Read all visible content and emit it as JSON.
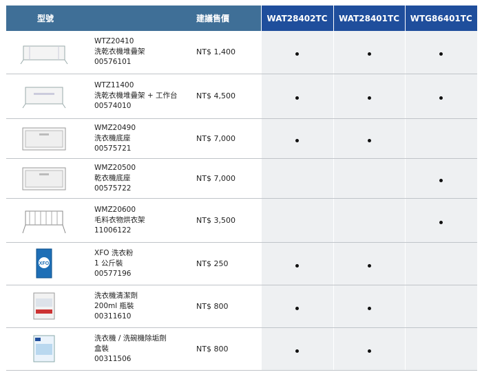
{
  "header": {
    "type_label": "型號",
    "price_label": "建議售價",
    "models": [
      "WAT28402TC",
      "WAT28401TC",
      "WTG86401TC"
    ]
  },
  "rows": [
    {
      "code": "WTZ20410",
      "name": "洗乾衣機堆疊架",
      "part": "00576101",
      "price": "NT$ 1,400",
      "marks": [
        true,
        true,
        true
      ],
      "icon": "stacking-kit-icon"
    },
    {
      "code": "WTZ11400",
      "name": "洗乾衣機堆疊架 + 工作台",
      "part": "00574010",
      "price": "NT$ 4,500",
      "marks": [
        true,
        true,
        true
      ],
      "icon": "stacking-kit-table-icon"
    },
    {
      "code": "WMZ20490",
      "name": "洗衣機底座",
      "part": "00575721",
      "price": "NT$ 7,000",
      "marks": [
        true,
        true,
        false
      ],
      "icon": "pedestal-drawer-icon"
    },
    {
      "code": "WMZ20500",
      "name": "乾衣機底座",
      "part": "00575722",
      "price": "NT$ 7,000",
      "marks": [
        false,
        false,
        true
      ],
      "icon": "pedestal-drawer-icon"
    },
    {
      "code": "WMZ20600",
      "name": "毛料衣物烘衣架",
      "part": "11006122",
      "price": "NT$ 3,500",
      "marks": [
        false,
        false,
        true
      ],
      "icon": "drying-rack-icon"
    },
    {
      "code": "XFO 洗衣粉",
      "name": "1 公斤裝",
      "part": "00577196",
      "price": "NT$ 250",
      "marks": [
        true,
        true,
        false
      ],
      "icon": "detergent-box-icon"
    },
    {
      "code": "洗衣機清潔劑",
      "name": "200ml 瓶裝",
      "part": "00311610",
      "price": "NT$ 800",
      "marks": [
        true,
        true,
        false
      ],
      "icon": "cleaner-bottle-icon"
    },
    {
      "code": "洗衣機 / 洗碗機除垢劑",
      "name": "盒裝",
      "part": "00311506",
      "price": "NT$ 800",
      "marks": [
        true,
        true,
        false
      ],
      "icon": "descaler-box-icon"
    }
  ],
  "icon_images": {
    "detergent_logo": "XFO"
  }
}
